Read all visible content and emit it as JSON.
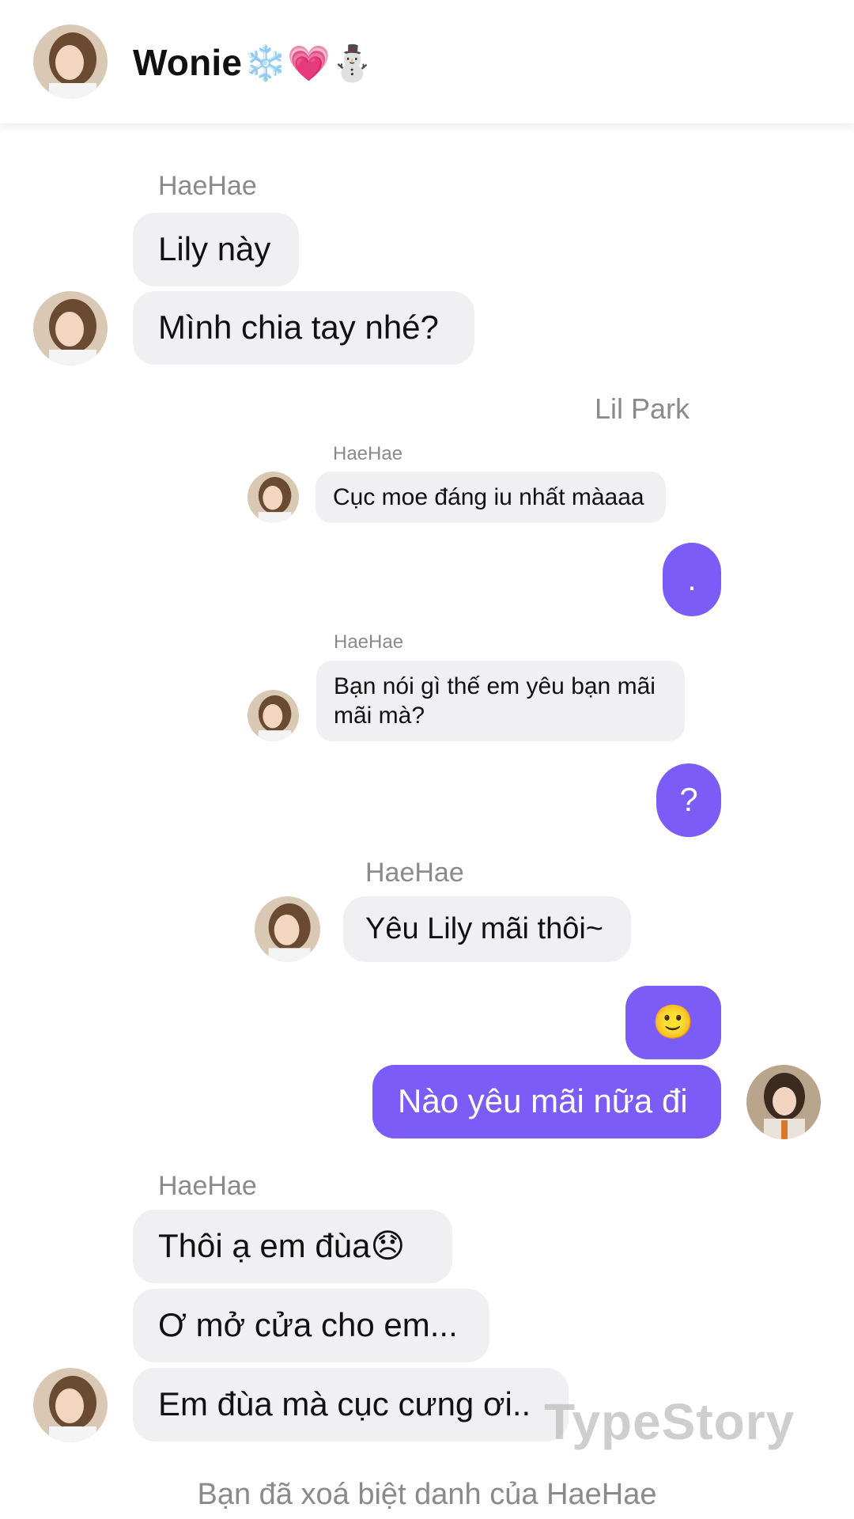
{
  "header": {
    "contact_name": "Wonie",
    "contact_emojis": "❄️💗⛄️"
  },
  "messages": {
    "group1": {
      "sender": "HaeHae",
      "lines": [
        "Lily này",
        "Mình chia tay nhé?"
      ]
    },
    "reply_sender": "Lil Park",
    "embedded": {
      "m1": {
        "sender": "HaeHae",
        "text": "Cục moe đáng iu nhất màaaa"
      },
      "r1": ".",
      "m2": {
        "sender": "HaeHae",
        "text": "Bạn nói gì thế em yêu bạn mãi mãi mà?"
      },
      "r2": "?",
      "m3": {
        "sender": "HaeHae",
        "text": "Yêu Lily mãi thôi~"
      },
      "r3": "🙂",
      "r4": "Nào yêu mãi nữa đi"
    },
    "group2": {
      "sender": "HaeHae",
      "lines": [
        "Thôi ạ em đùa😞",
        "Ơ mở cửa cho em...",
        "Em đùa mà cục cưng ơi.."
      ]
    }
  },
  "system_note": "Bạn đã xoá biệt danh của HaeHae",
  "watermark": "TypeStory",
  "colors": {
    "my_bubble": "#7b5cf6",
    "their_bubble": "#f0f0f2",
    "meta_text": "#8a8a8e"
  }
}
